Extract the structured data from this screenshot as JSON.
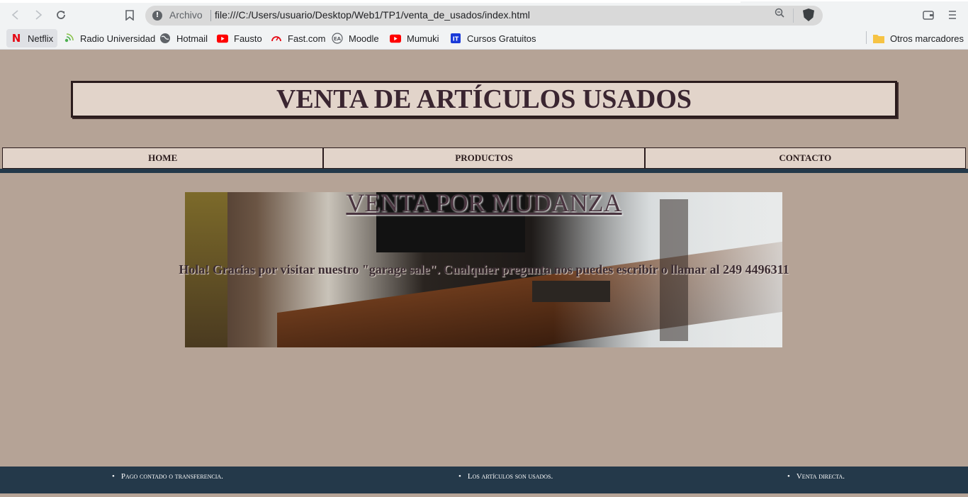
{
  "browser": {
    "omnibox": {
      "security_label": "Archivo",
      "url": "file:///C:/Users/usuario/Desktop/Web1/TP1/venta_de_usados/index.html"
    },
    "bookmarks": [
      {
        "label": "Netflix",
        "icon": "netflix-icon",
        "color": "#e50914"
      },
      {
        "label": "Radio Universidad",
        "icon": "radio-icon",
        "color": "#4caf50"
      },
      {
        "label": "Hotmail",
        "icon": "globe-icon",
        "color": "#5f6368"
      },
      {
        "label": "Fausto",
        "icon": "youtube-icon",
        "color": "#ff0000"
      },
      {
        "label": "Fast.com",
        "icon": "speedometer-icon",
        "color": "#e50914"
      },
      {
        "label": "Moodle",
        "icon": "moodle-icon",
        "color": "#5f6368"
      },
      {
        "label": "Mumuki",
        "icon": "youtube-icon",
        "color": "#ff0000"
      },
      {
        "label": "Cursos Gratuitos",
        "icon": "it-icon",
        "color": "#1a3ad8"
      }
    ],
    "other_bookmarks": "Otros marcadores"
  },
  "page": {
    "title": "VENTA DE ARTÍCULOS USADOS",
    "nav": [
      "HOME",
      "PRODUCTOS",
      "CONTACTO"
    ],
    "hero": {
      "title": "VENTA POR MUDANZA",
      "text": "Hola! Gracias por visitar nuestro \"garage sale\". Cualquier pregunta nos puedes escribir o llamar al 249 4496311"
    },
    "footer": [
      "Pago contado o transferencia.",
      "Los artículos son usados.",
      "Venta directa."
    ]
  },
  "colors": {
    "background": "#b5a396",
    "box": "#e2d4ca",
    "dark_band": "#24394a",
    "title_text": "#3a2530"
  }
}
